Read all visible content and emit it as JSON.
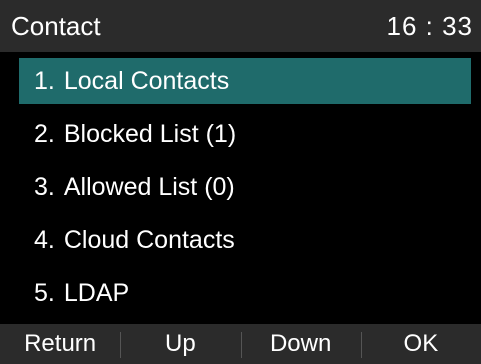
{
  "header": {
    "title": "Contact",
    "time": "16 : 33"
  },
  "menu": {
    "items": [
      {
        "number": "1.",
        "label": "Local Contacts",
        "selected": true
      },
      {
        "number": "2.",
        "label": "Blocked List (1)",
        "selected": false
      },
      {
        "number": "3.",
        "label": "Allowed List (0)",
        "selected": false
      },
      {
        "number": "4.",
        "label": "Cloud Contacts",
        "selected": false
      },
      {
        "number": "5.",
        "label": "LDAP",
        "selected": false
      }
    ]
  },
  "softkeys": {
    "return_label": "Return",
    "up_label": "Up",
    "down_label": "Down",
    "ok_label": "OK"
  },
  "colors": {
    "background": "#000000",
    "bar": "#2b2b2b",
    "highlight": "#1f6b6b",
    "text": "#ffffff"
  }
}
